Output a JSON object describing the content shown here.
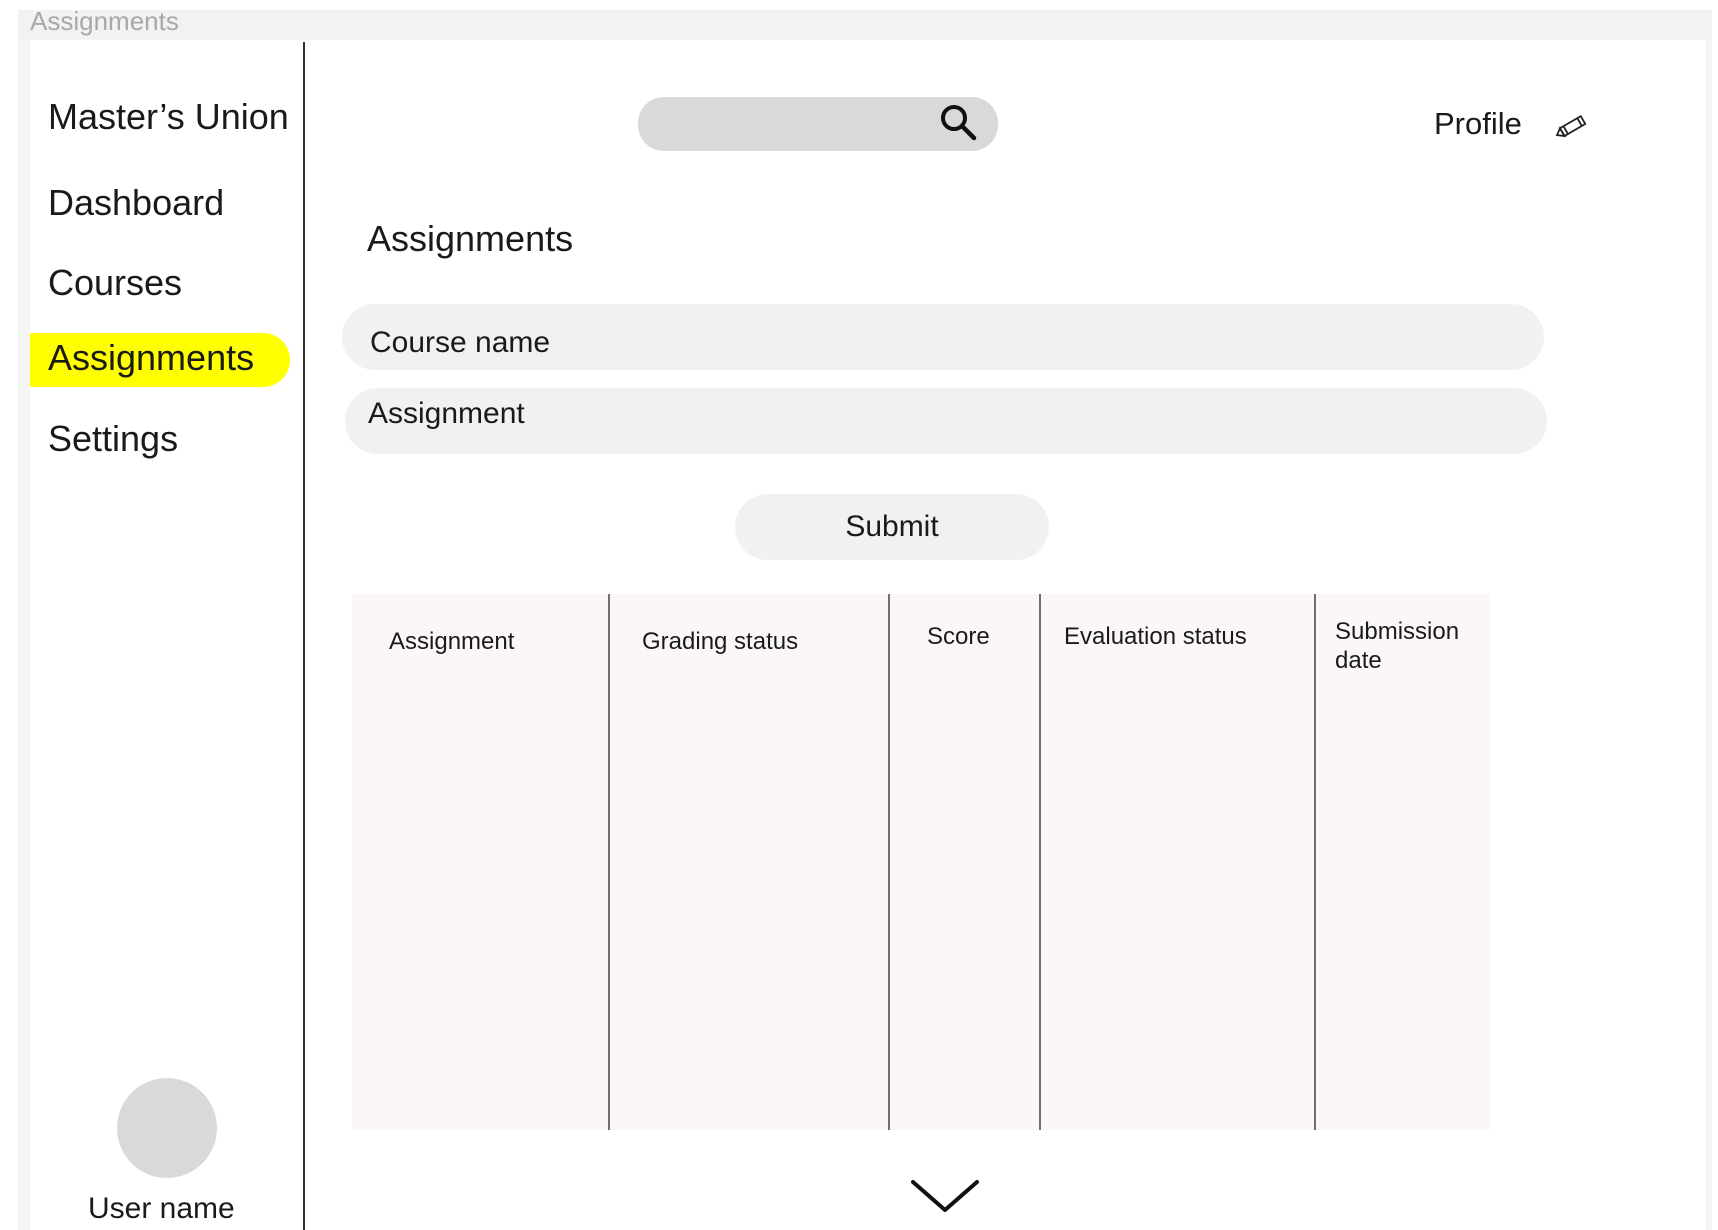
{
  "frame": {
    "title": "Assignments"
  },
  "sidebar": {
    "brand": "Master’s Union",
    "items": [
      {
        "label": "Dashboard"
      },
      {
        "label": "Courses"
      },
      {
        "label": "Assignments",
        "active": true
      },
      {
        "label": "Settings"
      }
    ],
    "user": {
      "name": "User name"
    }
  },
  "header": {
    "search": {
      "value": "",
      "icon": "search-icon"
    },
    "profile": {
      "label": "Profile",
      "icon": "pencil-icon"
    }
  },
  "main": {
    "title": "Assignments",
    "form": {
      "course_name_label": "Course name",
      "assignment_label": "Assignment",
      "submit_label": "Submit"
    },
    "table": {
      "columns": [
        "Assignment",
        "Grading status",
        "Score",
        "Evaluation status",
        "Submission date"
      ]
    },
    "more_icon": "chevron-down-icon"
  },
  "colors": {
    "active_highlight": "#ffff00",
    "input_bg": "#f1f1f1",
    "search_bg": "#d9d9d9",
    "table_bg": "#fcf7f7"
  }
}
